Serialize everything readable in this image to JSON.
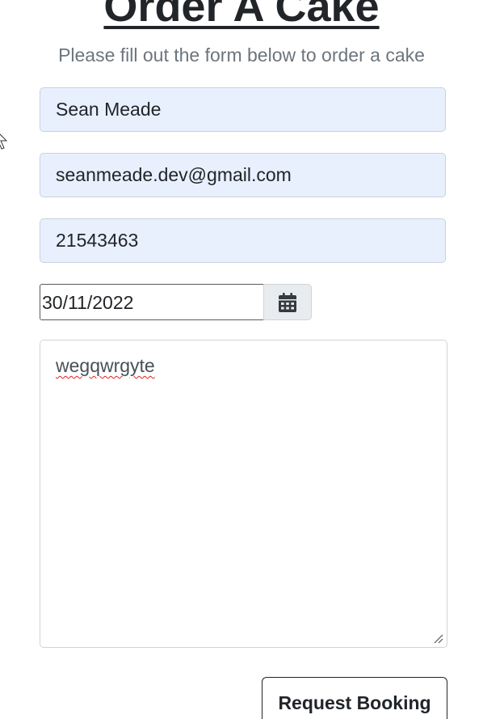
{
  "page": {
    "title": "Order A Cake",
    "subtitle": "Please fill out the form below to order a cake"
  },
  "form": {
    "name_value": "Sean Meade",
    "email_value": "seanmeade.dev@gmail.com",
    "phone_value": "21543463",
    "date_value": "30/11/2022",
    "message_value": "wegqwrgyte",
    "submit_label": "Request Booking"
  },
  "icons": {
    "date_picker": "calendar-icon",
    "resize": "resize-handle-icon",
    "cursor": "mouse-pointer-icon"
  },
  "colors": {
    "autofill_bg": "#e8f0fe",
    "muted_text": "#6c757d",
    "spell_error": "#e02020"
  }
}
